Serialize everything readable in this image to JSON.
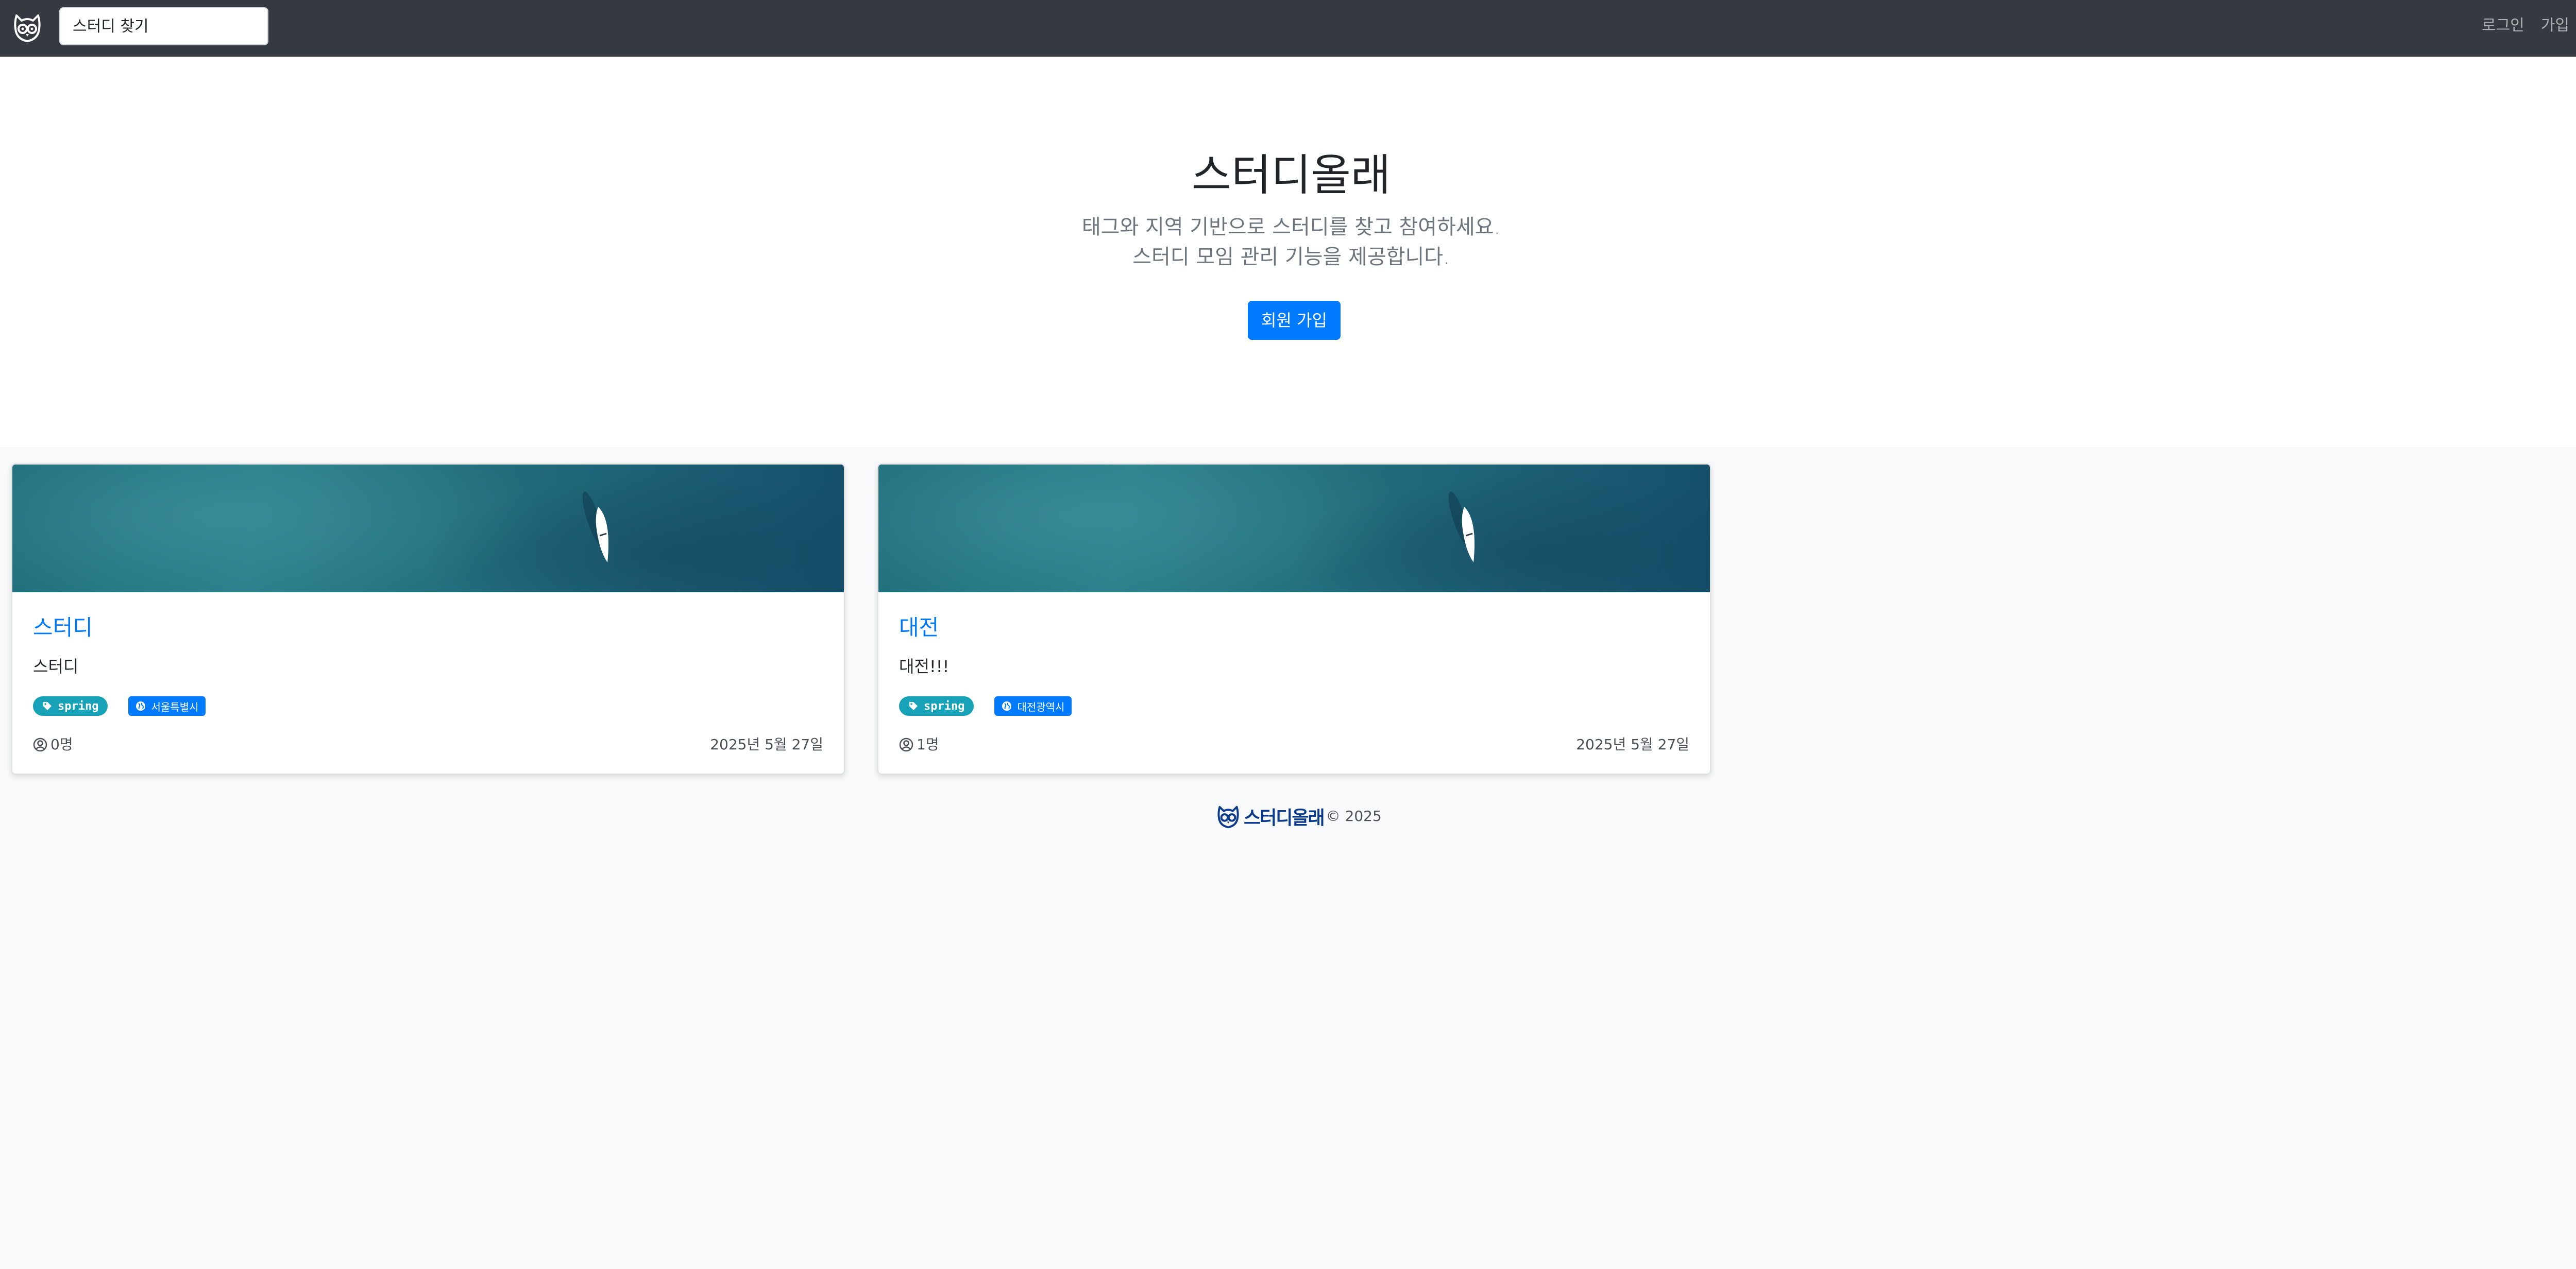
{
  "navbar": {
    "logo_icon": "owl-logo-icon",
    "search_placeholder": "스터디 찾기",
    "login_label": "로그인",
    "signup_label": "가입"
  },
  "hero": {
    "title": "스터디올래",
    "lead_line1": "태그와 지역 기반으로 스터디를 찾고 참여하세요.",
    "lead_line2": "스터디 모임 관리 기능을 제공합니다.",
    "join_button_label": "회원 가입"
  },
  "studies": [
    {
      "title": "스터디",
      "description": "스터디",
      "tag": "spring",
      "zone": "서울특별시",
      "members": "0명",
      "date": "2025년 5월 27일"
    },
    {
      "title": "대전",
      "description": "대전!!!",
      "tag": "spring",
      "zone": "대전광역시",
      "members": "1명",
      "date": "2025년 5월 27일"
    }
  ],
  "footer": {
    "logo_text": "스터디올래",
    "copyright": "© 2025"
  },
  "colors": {
    "navbar_bg": "#343a40",
    "primary": "#007bff",
    "tag_badge": "#17a2b8",
    "page_bg": "#f8f9fa",
    "hero_bg": "#ffffff"
  }
}
